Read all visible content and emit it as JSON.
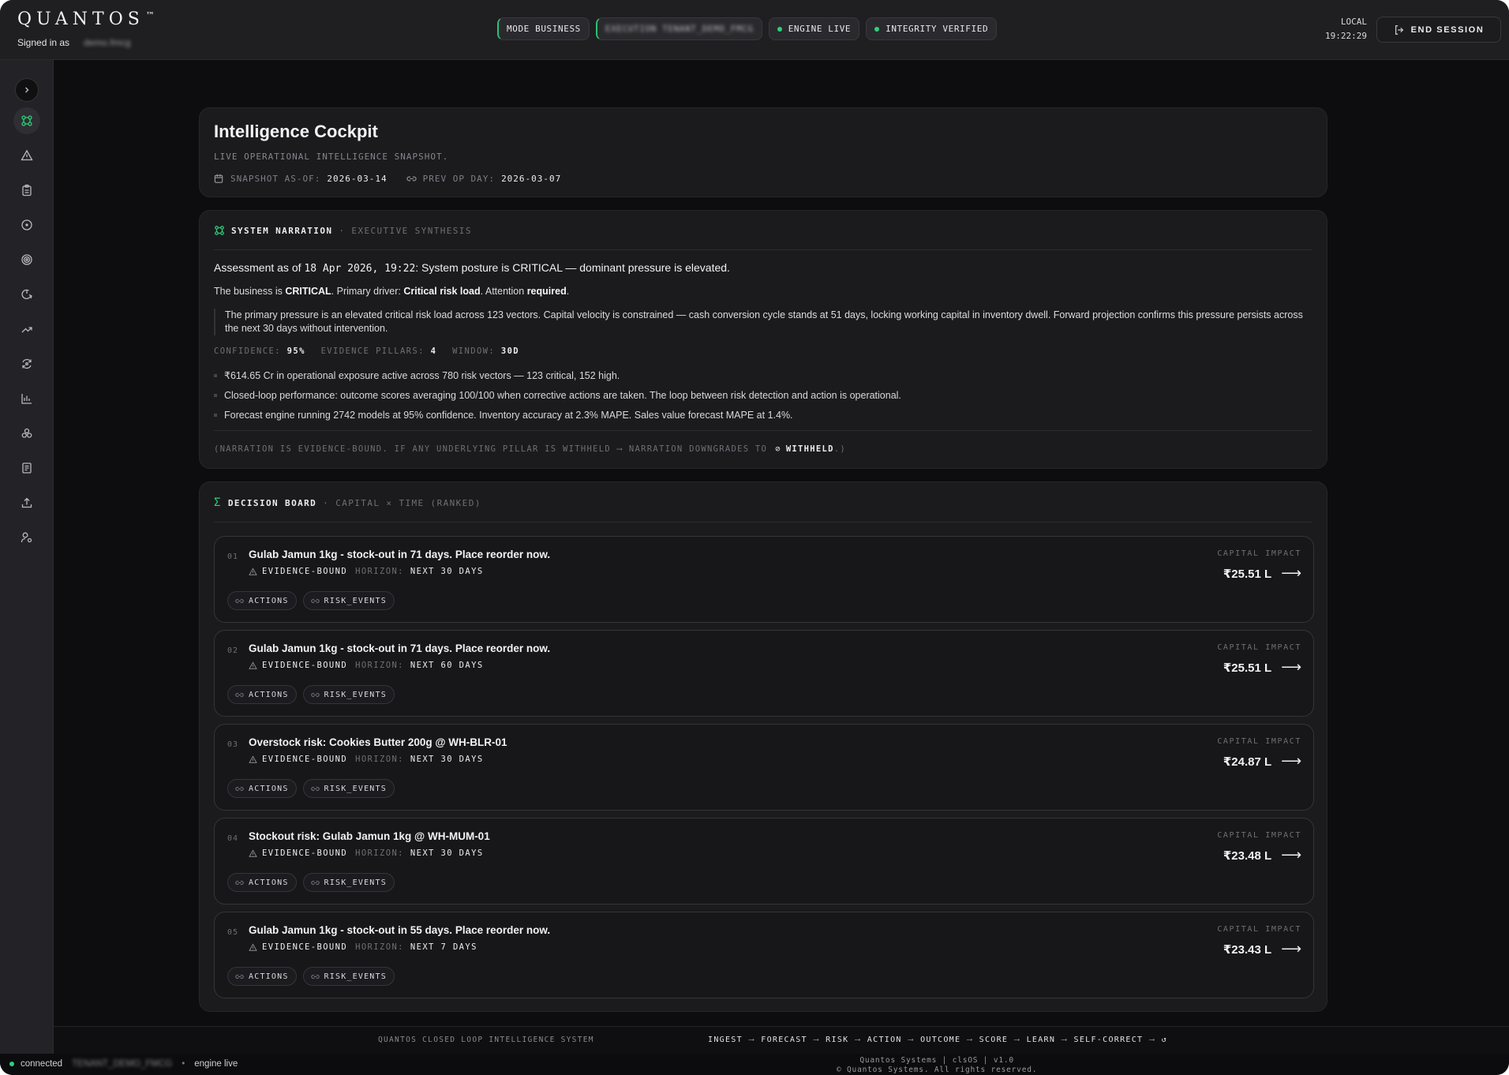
{
  "header": {
    "brand": "QUANTOS",
    "brand_mark": "™",
    "signed_in_label": "Signed in as",
    "user": "demo.fmcg",
    "pills": [
      {
        "label": "MODE BUSINESS"
      },
      {
        "label": "EXECUTION TENANT_DEMO_FMCG"
      },
      {
        "label": "ENGINE LIVE"
      },
      {
        "label": "INTEGRITY VERIFIED"
      }
    ],
    "clock_label": "LOCAL",
    "clock_time": "19:22:29",
    "end_session": "END SESSION"
  },
  "sidebar": {
    "items": [
      {
        "icon": "network-icon"
      },
      {
        "icon": "alert-triangle-icon"
      },
      {
        "icon": "clipboard-icon"
      },
      {
        "icon": "target-dot-icon"
      },
      {
        "icon": "radar-icon"
      },
      {
        "icon": "power-cycle-icon"
      },
      {
        "icon": "trending-up-icon"
      },
      {
        "icon": "refresh-cycle-icon"
      },
      {
        "icon": "bar-chart-icon"
      },
      {
        "icon": "modules-icon"
      },
      {
        "icon": "document-icon"
      },
      {
        "icon": "upload-icon"
      },
      {
        "icon": "user-settings-icon"
      }
    ]
  },
  "cockpit": {
    "title": "Intelligence Cockpit",
    "subtitle": "LIVE OPERATIONAL INTELLIGENCE SNAPSHOT.",
    "snapshot_label": "SNAPSHOT AS-OF:",
    "snapshot_value": "2026-03-14",
    "prev_label": "PREV OP DAY:",
    "prev_value": "2026-03-07"
  },
  "narration": {
    "heading": "SYSTEM NARRATION",
    "sub": "· EXECUTIVE SYNTHESIS",
    "lead_prefix": "Assessment as of ",
    "lead_ts": "18 Apr 2026, 19:22",
    "lead_suffix": ": System posture is CRITICAL — dominant pressure is elevated.",
    "l2_a": "The business is ",
    "l2_b": "CRITICAL",
    "l2_c": ". Primary driver: ",
    "l2_d": "Critical risk load",
    "l2_e": ". Attention ",
    "l2_f": "required",
    "l2_g": ".",
    "quote": "The primary pressure is an elevated critical risk load across 123 vectors. Capital velocity is constrained — cash conversion cycle stands at 51 days, locking working capital in inventory dwell. Forward projection confirms this pressure persists across the next 30 days without intervention.",
    "confidence_label": "CONFIDENCE:",
    "confidence_value": "95%",
    "pillars_label": "EVIDENCE PILLARS:",
    "pillars_value": "4",
    "window_label": "WINDOW:",
    "window_value": "30D",
    "bullets": [
      "₹614.65 Cr in operational exposure active across 780 risk vectors — 123 critical, 152 high.",
      "Closed-loop performance: outcome scores averaging 100/100 when corrective actions are taken. The loop between risk detection and action is operational.",
      "Forecast engine running 2742 models at 95% confidence. Inventory accuracy at 2.3% MAPE. Sales value forecast MAPE at 1.4%."
    ],
    "footnote_a": "(NARRATION IS EVIDENCE-BOUND. IF ANY UNDERLYING PILLAR IS WITHHELD ⟶ NARRATION DOWNGRADES TO",
    "footnote_b": "WITHHELD",
    "footnote_c": ".)"
  },
  "decision_board": {
    "heading": "DECISION BOARD",
    "sub": "· CAPITAL × TIME (RANKED)",
    "capital_label": "CAPITAL IMPACT",
    "evidence_label": "EVIDENCE-BOUND",
    "horizon_label": "HORIZON:",
    "tag_actions": "ACTIONS",
    "tag_risk": "RISK_EVENTS",
    "items": [
      {
        "num": "01",
        "title": "Gulab Jamun 1kg - stock-out in 71 days. Place reorder now.",
        "horizon": "NEXT 30 DAYS",
        "impact": "₹25.51 L"
      },
      {
        "num": "02",
        "title": "Gulab Jamun 1kg - stock-out in 71 days. Place reorder now.",
        "horizon": "NEXT 60 DAYS",
        "impact": "₹25.51 L"
      },
      {
        "num": "03",
        "title": "Overstock risk: Cookies Butter 200g @ WH-BLR-01",
        "horizon": "NEXT 30 DAYS",
        "impact": "₹24.87 L"
      },
      {
        "num": "04",
        "title": "Stockout risk: Gulab Jamun 1kg @ WH-MUM-01",
        "horizon": "NEXT 30 DAYS",
        "impact": "₹23.48 L"
      },
      {
        "num": "05",
        "title": "Gulab Jamun 1kg - stock-out in 55 days. Place reorder now.",
        "horizon": "NEXT 7 DAYS",
        "impact": "₹23.43 L"
      }
    ]
  },
  "footer": {
    "system": "QUANTOS CLOSED LOOP INTELLIGENCE SYSTEM",
    "loop": [
      "INGEST",
      "FORECAST",
      "RISK",
      "ACTION",
      "OUTCOME",
      "SCORE",
      "LEARN",
      "SELF-CORRECT"
    ],
    "loop_end": "↺"
  },
  "statusbar": {
    "connected": "connected",
    "tenant": "TENANT_DEMO_FMCG",
    "sep": "•",
    "engine": "engine live",
    "version": "Quantos Systems | clsOS | v1.0",
    "copyright": "© Quantos Systems. All rights reserved."
  },
  "colors": {
    "accent_green": "#2fd07a",
    "background": "#0d0d0f",
    "card": "#1b1b1e"
  }
}
